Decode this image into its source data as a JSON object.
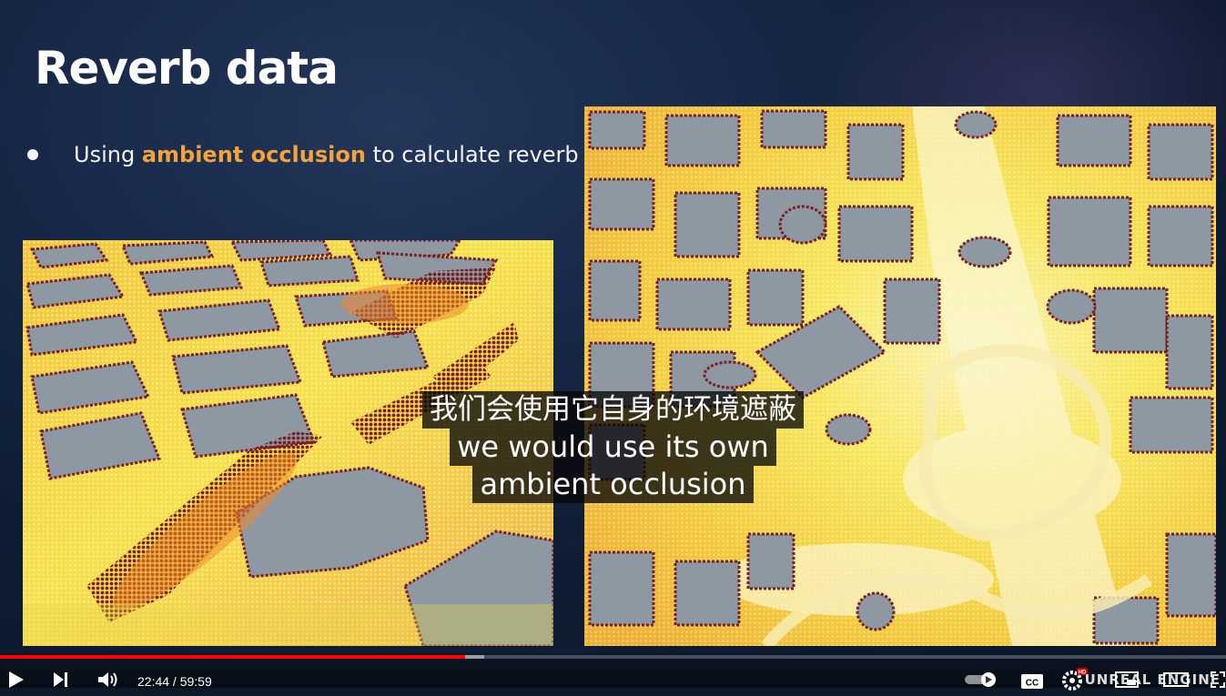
{
  "slide": {
    "title": "Reverb data",
    "bullet": {
      "before": "Using ",
      "highlight": "ambient occlusion",
      "after": " to calculate reverb"
    }
  },
  "subtitles": {
    "line_zh": "我们会使用它自身的环境遮蔽",
    "line_en_1": "we would use its own",
    "line_en_2": "ambient occlusion"
  },
  "player": {
    "current_time": "22:44",
    "duration": "59:59",
    "time_display": "22:44 / 59:59",
    "progress_fraction": 0.379,
    "hd_badge": "HD",
    "cc_label": "CC",
    "watermark": "UNREAL ENGINE",
    "accent_color": "#ff0000"
  },
  "icons": [
    "play-icon",
    "next-icon",
    "volume-icon",
    "autoplay-toggle-icon",
    "cc-icon",
    "settings-icon",
    "miniplayer-icon",
    "theater-icon",
    "fullscreen-icon"
  ],
  "colors": {
    "highlight": "#f4a23a",
    "heat_yellow": "#f6e14a",
    "heat_orange": "#ee8a2c",
    "building_grey": "#8e98a2",
    "wall_red": "#7a1f22"
  }
}
